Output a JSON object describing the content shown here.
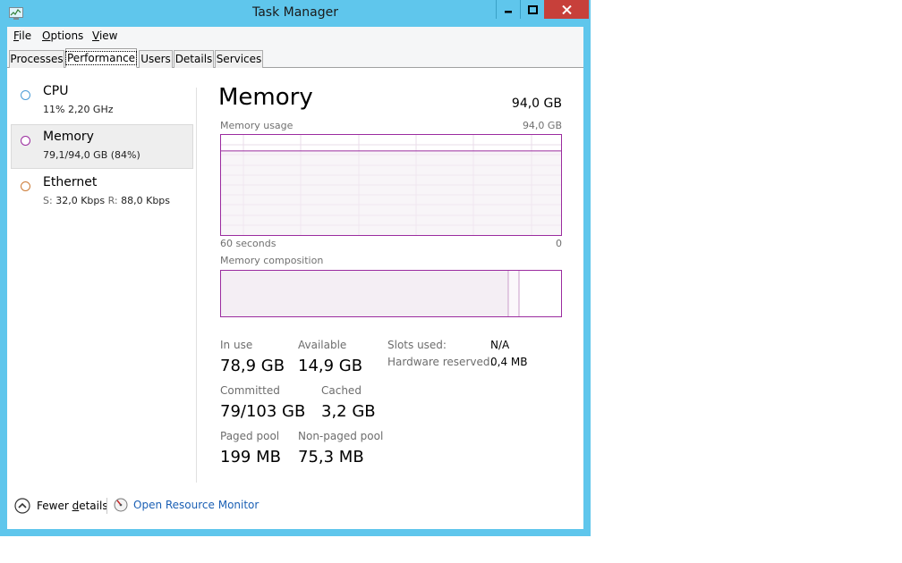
{
  "window": {
    "title": "Task Manager",
    "icon": "task-manager-icon",
    "controls": {
      "minimize": "minimize-icon",
      "maximize": "maximize-icon",
      "close": "close-icon"
    }
  },
  "menu": [
    {
      "label": "File",
      "mnemonic": "F",
      "rest": "ile"
    },
    {
      "label": "Options",
      "mnemonic": "O",
      "rest": "ptions"
    },
    {
      "label": "View",
      "mnemonic": "V",
      "rest": "iew"
    }
  ],
  "tabs": [
    "Processes",
    "Performance",
    "Users",
    "Details",
    "Services"
  ],
  "active_tab": "Performance",
  "sidebar": [
    {
      "title": "CPU",
      "sub": "11%  2,20 GHz",
      "color": "#4a9cd6"
    },
    {
      "title": "Memory",
      "sub": "79,1/94,0 GB (84%)",
      "color": "#9b2c9f"
    },
    {
      "title": "Ethernet",
      "sub_s_label": "S:",
      "sub_s_value": "32,0 Kbps",
      "sub_r_label": "R:",
      "sub_r_value": "88,0 Kbps",
      "color": "#cc7a35"
    }
  ],
  "panel": {
    "title": "Memory",
    "total": "94,0 GB",
    "usage_label": "Memory usage",
    "usage_max": "94,0 GB",
    "usage_percent": 84,
    "axis_left": "60 seconds",
    "axis_right": "0",
    "composition_label": "Memory composition",
    "stats": {
      "in_use_label": "In use",
      "in_use": "78,9 GB",
      "available_label": "Available",
      "available": "14,9 GB",
      "committed_label": "Committed",
      "committed": "79/103 GB",
      "cached_label": "Cached",
      "cached": "3,2 GB",
      "paged_label": "Paged pool",
      "paged": "199 MB",
      "nonpaged_label": "Non-paged pool",
      "nonpaged": "75,3 MB"
    },
    "info": {
      "slots_label": "Slots used:",
      "slots": "N/A",
      "hw_label": "Hardware reserved:",
      "hw": "0,4 MB"
    },
    "accent": "#9b2c9f"
  },
  "footer": {
    "fewer_pre": "Fewer ",
    "fewer_mn": "d",
    "fewer_post": "etails",
    "open_monitor": "Open Resource Monitor"
  }
}
